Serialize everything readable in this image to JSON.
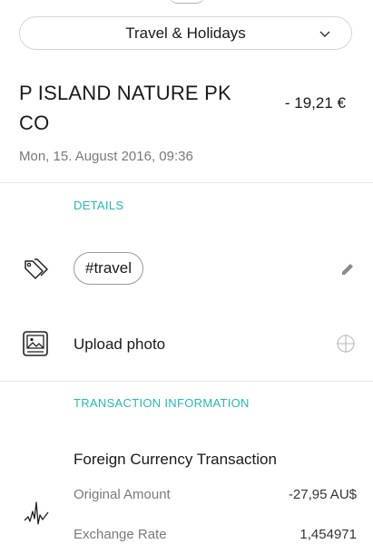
{
  "category": {
    "label": "Travel & Holidays",
    "icon": "chevron-down-icon"
  },
  "transaction": {
    "merchant": "P ISLAND NATURE PK CO",
    "amount": "- 19,21 €",
    "datetime": "Mon, 15. August 2016, 09:36"
  },
  "details": {
    "title": "DETAILS",
    "tag": "#travel",
    "tag_icon": "tags-icon",
    "edit_icon": "pencil-icon",
    "upload_label": "Upload photo",
    "upload_icon": "image-icon",
    "add_photo_icon": "crosshair-add-icon"
  },
  "transaction_info": {
    "title": "TRANSACTION INFORMATION",
    "heading": "Foreign Currency Transaction",
    "icon": "exchange-chart-icon",
    "rows": [
      {
        "label": "Original Amount",
        "value": "-27,95 AU$"
      },
      {
        "label": "Exchange Rate",
        "value": "1,454971"
      }
    ]
  },
  "colors": {
    "accent": "#26b8b2",
    "muted": "#7a7a7a",
    "border": "#d6d6d6"
  }
}
